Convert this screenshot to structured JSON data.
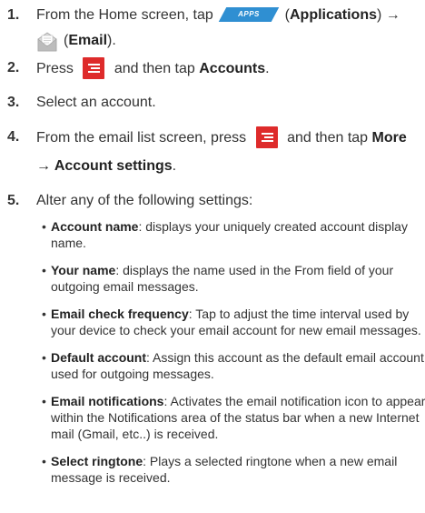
{
  "steps": [
    {
      "num": "1.",
      "part_a": "From the Home screen, tap",
      "apps_label": "APPS",
      "part_b": "(",
      "part_b_bold": "Applications",
      "part_c": ") →",
      "line2_a": "(",
      "line2_bold": "Email",
      "line2_b": ")."
    },
    {
      "num": "2.",
      "pre": "Press",
      "post": "and then tap",
      "bold": "Accounts",
      "end": "."
    },
    {
      "num": "3.",
      "text": "Select an account."
    },
    {
      "num": "4.",
      "pre": "From the email list screen, press",
      "post": "and then tap",
      "bold": "More",
      "line2_bold": "→ Account settings",
      "end": "."
    },
    {
      "num": "5.",
      "text": "Alter any of the following settings:"
    }
  ],
  "settings": [
    {
      "term": "Account name",
      "lines": [
        ": displays your uniquely created account display",
        "name."
      ]
    },
    {
      "term": "Your name",
      "lines": [
        ": displays the name used in the From field of your",
        "outgoing email messages."
      ]
    },
    {
      "term": "Email check frequency",
      "lines": [
        ": Tap to adjust the time interval used by",
        "your device to check your email account for new email messages."
      ]
    },
    {
      "term": "Default account",
      "lines": [
        ": Assign this account as the default email account",
        "used for outgoing messages."
      ]
    },
    {
      "term": "Email notifications",
      "lines": [
        ": Activates the email notification icon to appear",
        "within the Notifications area of the status bar when a new Internet",
        "mail (Gmail, etc..) is received."
      ]
    },
    {
      "term": "Select ringtone",
      "lines": [
        ": Plays a selected ringtone when a new email",
        "message is received."
      ]
    }
  ],
  "icons": {
    "menu": "menu-key-icon",
    "apps": "apps-icon",
    "email": "email-icon"
  },
  "colors": {
    "apps": "#2f8fd2",
    "menu": "#de2b2b"
  }
}
